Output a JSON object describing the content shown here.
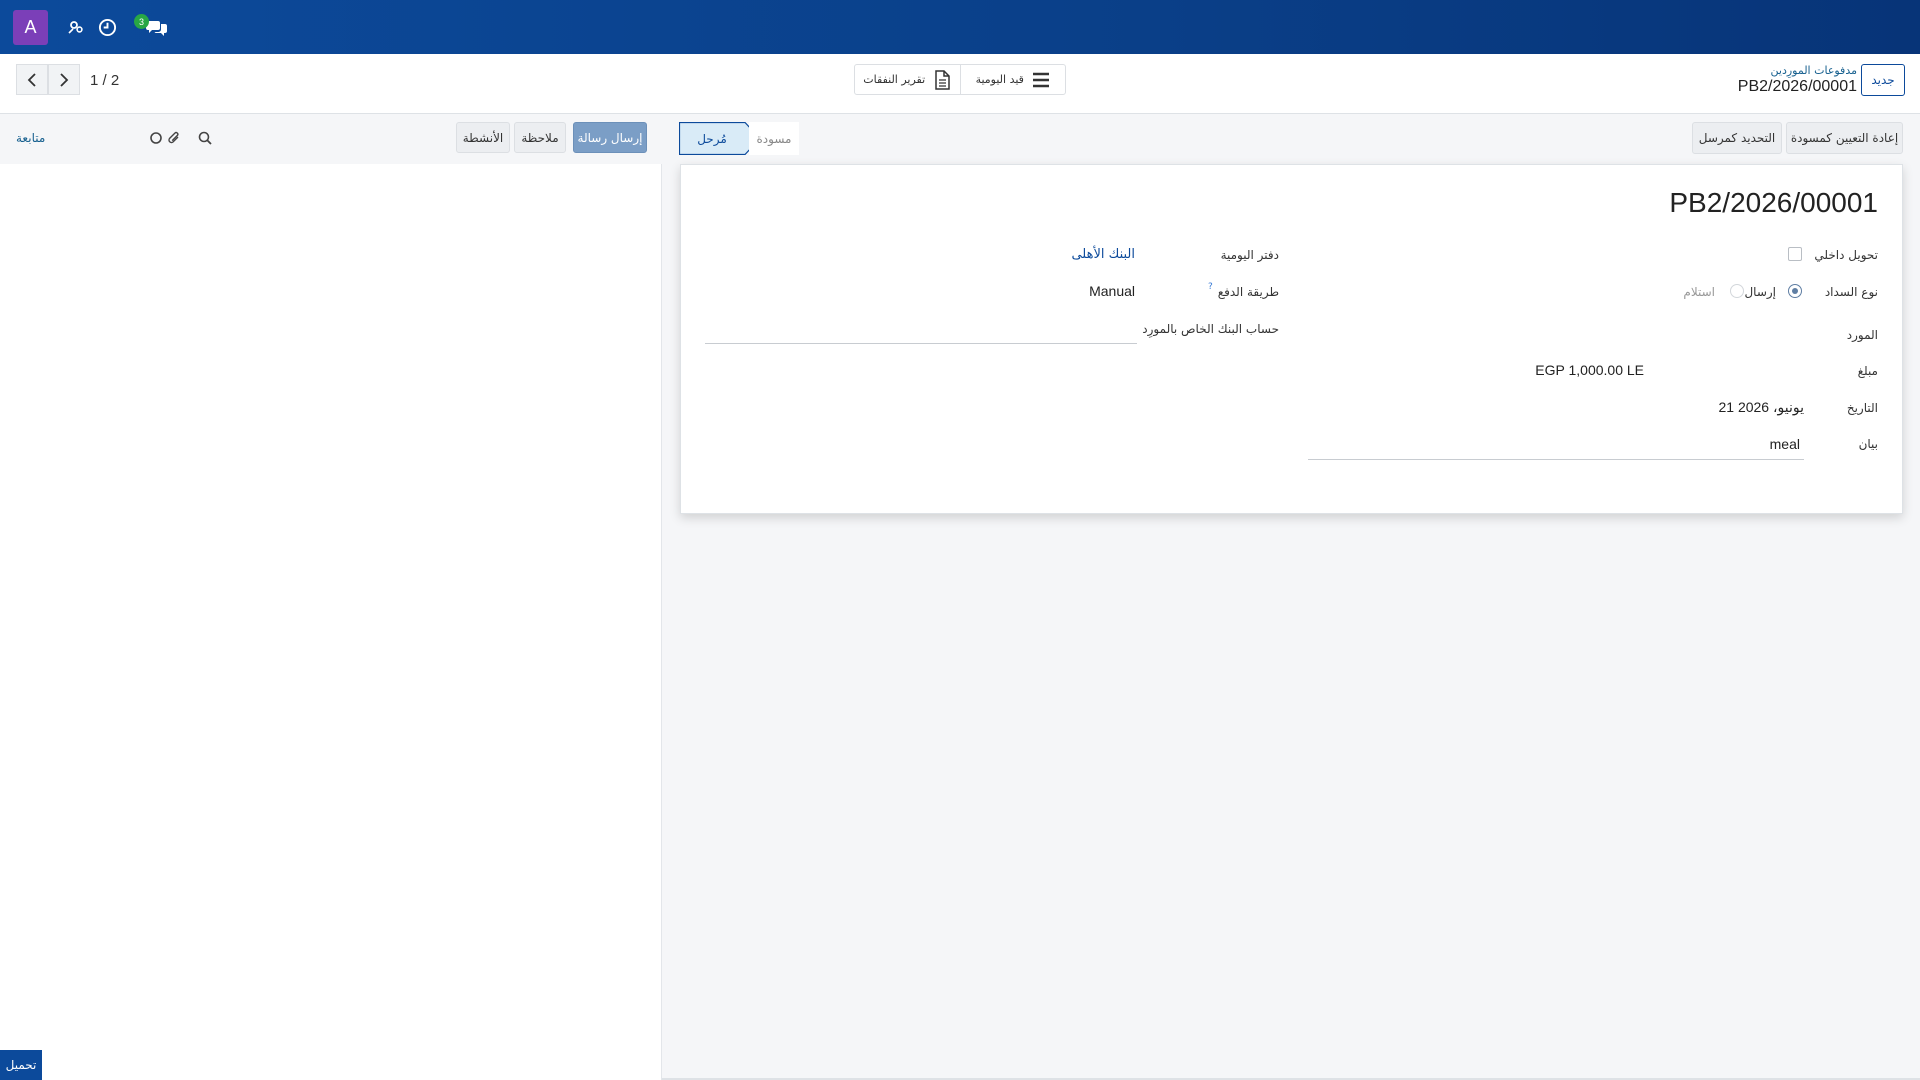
{
  "navbar": {
    "avatar_letter": "A",
    "icons": [
      "users-gear-icon",
      "clock-icon",
      "chat-icon"
    ],
    "chat_badge": "3",
    "colors": {
      "background": "#0c4a9b",
      "avatar": "#7b3fb8",
      "badge": "#28a745"
    }
  },
  "control_panel": {
    "pager_value": "1 / 2",
    "toolbar": {
      "expense_report": "تقرير النفقات",
      "journal_entry": "قيد اليومية"
    },
    "breadcrumb_parent": "مدفوعات المورِدين",
    "breadcrumb_title": "PB2/2026/00001",
    "new_button": "جديد"
  },
  "chatter": {
    "send_message": "إرسال رسالة",
    "log_note": "ملاحظة",
    "activities": "الأنشطة",
    "follow": "متابعة"
  },
  "upload_button": "تحميل",
  "statusbar": {
    "reset_to_draft": "إعادة التعيين كمسودة",
    "mark_as_sent": "التحديد كمرسل",
    "stages": {
      "posted": "مُرحل",
      "draft": "مسودة"
    }
  },
  "form": {
    "record_name": "PB2/2026/00001",
    "internal_transfer_label": "تحويل داخلي",
    "payment_type_label": "نوع السداد",
    "payment_type_options": {
      "send": "إرسال",
      "receive": "استلام"
    },
    "vendor_label": "المورد",
    "amount_label": "مبلغ",
    "amount_value": "EGP 1,000.00 LE",
    "date_label": "التاريخ",
    "date_value": "21 يونيو، 2026",
    "memo_label": "بيان",
    "memo_value": "meal",
    "journal_label": "دفتر اليومية",
    "journal_value": "البنك الأهلى",
    "payment_method_label": "طريقة الدفع",
    "payment_method_value": "Manual",
    "help_mark": "?",
    "vendor_bank_label": "حساب البنك الخاص بالمورِد"
  }
}
